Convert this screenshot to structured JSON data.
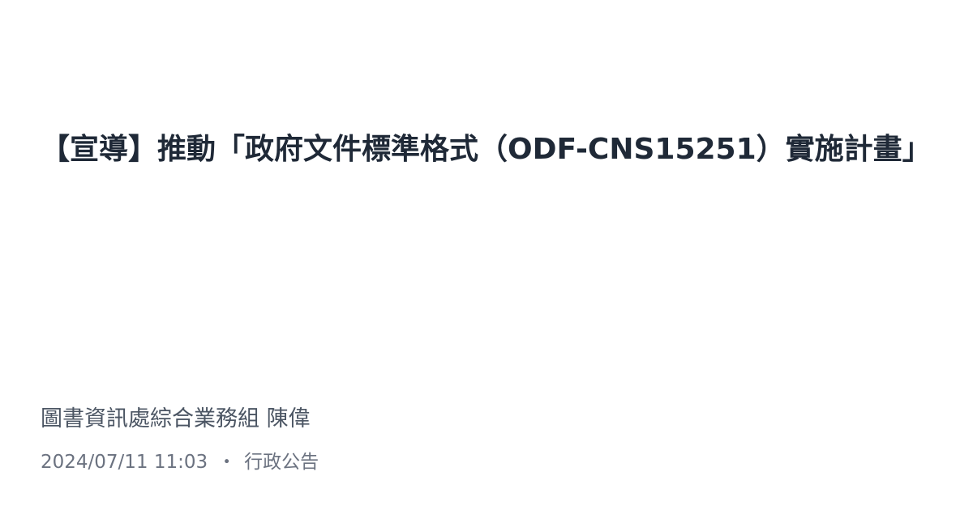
{
  "post": {
    "title": "【宣導】推動「政府文件標準格式（ODF-CNS15251）實施計畫」",
    "author": "圖書資訊處綜合業務組 陳偉",
    "datetime": "2024/07/11 11:03",
    "separator": "・",
    "category": "行政公告"
  }
}
